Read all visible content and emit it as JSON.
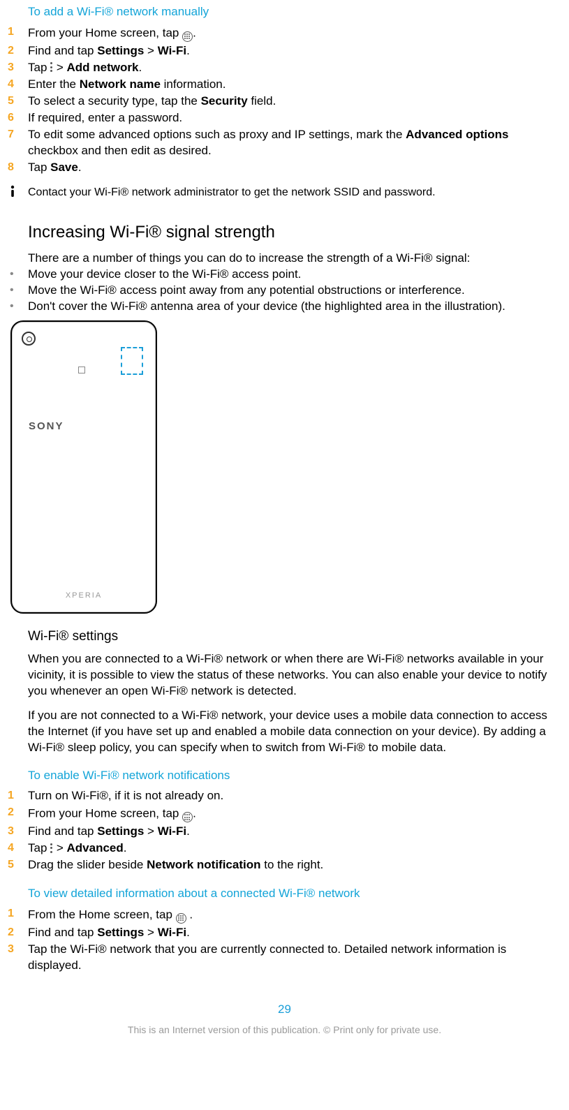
{
  "sec1": {
    "title": "To add a Wi-Fi® network manually",
    "s1a": "From your Home screen, tap ",
    "s1b": ".",
    "s2a": "Find and tap ",
    "s2b": "Settings",
    "s2c": " > ",
    "s2d": "Wi-Fi",
    "s2e": ".",
    "s3a": "Tap ",
    "s3c": " > ",
    "s3d": "Add network",
    "s3e": ".",
    "s4a": "Enter the ",
    "s4b": "Network name",
    "s4c": " information.",
    "s5a": "To select a security type, tap the ",
    "s5b": "Security",
    "s5c": " field.",
    "s6": "If required, enter a password.",
    "s7a": "To edit some advanced options such as proxy and IP settings, mark the ",
    "s7b": "Advanced options",
    "s7c": " checkbox and then edit as desired.",
    "s8a": "Tap ",
    "s8b": "Save",
    "s8c": ".",
    "note": "Contact your Wi-Fi® network administrator to get the network SSID and password."
  },
  "sec2": {
    "title": "Increasing Wi-Fi® signal strength",
    "intro": "There are a number of things you can do to increase the strength of a Wi-Fi® signal:",
    "b1": "Move your device closer to the Wi-Fi® access point.",
    "b2": "Move the Wi-Fi® access point away from any potential obstructions or interference.",
    "b3": "Don't cover the Wi-Fi® antenna area of your device (the highlighted area in the illustration).",
    "sony": "SONY",
    "xperia": "XPERIA"
  },
  "sec3": {
    "title": "Wi-Fi® settings",
    "p1": "When you are connected to a Wi-Fi® network or when there are Wi-Fi® networks available in your vicinity, it is possible to view the status of these networks. You can also enable your device to notify you whenever an open Wi-Fi® network is detected.",
    "p2": "If you are not connected to a Wi-Fi® network, your device uses a mobile data connection to access the Internet (if you have set up and enabled a mobile data connection on your device). By adding a Wi-Fi® sleep policy, you can specify when to switch from Wi-Fi® to mobile data."
  },
  "sec4": {
    "title": "To enable Wi-Fi® network notifications",
    "s1": "Turn on Wi-Fi®, if it is not already on.",
    "s2a": "From your Home screen, tap ",
    "s2b": ".",
    "s3a": "Find and tap ",
    "s3b": "Settings",
    "s3c": " > ",
    "s3d": "Wi-Fi",
    "s3e": ".",
    "s4a": "Tap ",
    "s4c": " > ",
    "s4d": "Advanced",
    "s4e": ".",
    "s5a": "Drag the slider beside ",
    "s5b": "Network notification",
    "s5c": " to the right."
  },
  "sec5": {
    "title": "To view detailed information about a connected Wi-Fi® network",
    "s1a": "From the Home screen, tap ",
    "s1b": " .",
    "s2a": "Find and tap ",
    "s2b": "Settings",
    "s2c": " > ",
    "s2d": "Wi-Fi",
    "s2e": ".",
    "s3": "Tap the Wi-Fi® network that you are currently connected to. Detailed network information is displayed."
  },
  "footer": {
    "page": "29",
    "disclaimer": "This is an Internet version of this publication. © Print only for private use."
  },
  "nums": {
    "n1": "1",
    "n2": "2",
    "n3": "3",
    "n4": "4",
    "n5": "5",
    "n6": "6",
    "n7": "7",
    "n8": "8"
  }
}
